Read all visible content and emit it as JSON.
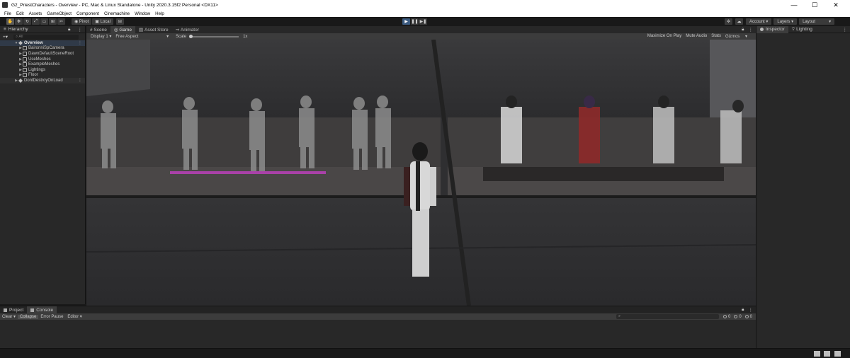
{
  "window": {
    "title": "G2_PriestCharacters - Overview - PC, Mac & Linux Standalone - Unity 2020.3.15f2 Personal <DX11>",
    "minimize": "—",
    "maximize": "☐",
    "close": "✕"
  },
  "menu": [
    "File",
    "Edit",
    "Assets",
    "GameObject",
    "Component",
    "Cinemachine",
    "Window",
    "Help"
  ],
  "toolbar": {
    "pivot": "Pivot",
    "local": "Local",
    "account": "Account",
    "layers": "Layers",
    "layout": "Layout"
  },
  "hierarchy": {
    "tab": "Hierarchy",
    "search_placeholder": "All",
    "scene": "Overview",
    "children": [
      "BaironniSpCamera",
      "DawnDefaultSceneRoot",
      "UseMeshes",
      "ExampleMeshes",
      "Lightings",
      "Floor"
    ],
    "dont_destroy": "DontDestroyOnLoad"
  },
  "view_tabs": [
    "Scene",
    "Game",
    "Asset Store",
    "Animator"
  ],
  "game_bar": {
    "display": "Display 1",
    "aspect": "Free Aspect",
    "scale_label": "Scale",
    "scale_value": "1x",
    "options": [
      "Maximize On Play",
      "Mute Audio",
      "Stats",
      "Gizmos"
    ]
  },
  "inspector": {
    "tabs": [
      "Inspector",
      "Lighting"
    ]
  },
  "bottom": {
    "tabs": [
      "Project",
      "Console"
    ],
    "console_buttons": [
      "Clear",
      "Collapse",
      "Error Pause",
      "Editor"
    ],
    "counts": [
      "0",
      "0",
      "0"
    ]
  },
  "colors": {
    "editor_bg": "#191919",
    "panel_bg": "#282828",
    "selection": "#303a48",
    "play_blue": "#3c5b80"
  }
}
